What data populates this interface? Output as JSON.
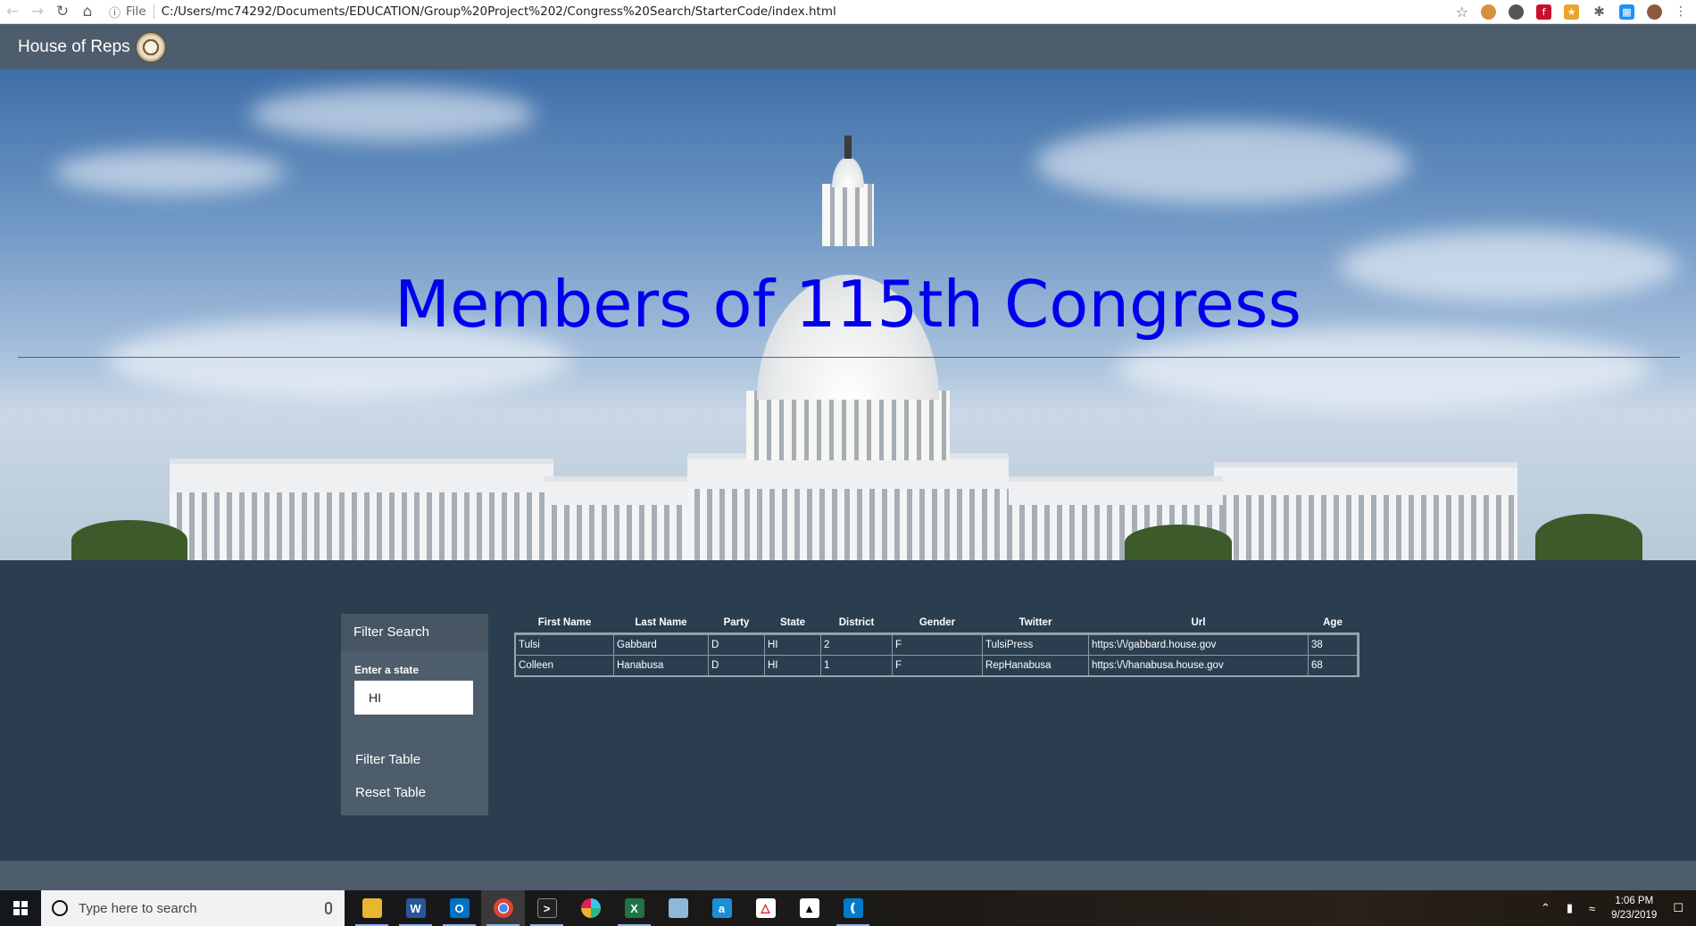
{
  "browser": {
    "protocol_label": "File",
    "url": "C:/Users/mc74292/Documents/EDUCATION/Group%20Project%202/Congress%20Search/StarterCode/index.html"
  },
  "navbar": {
    "brand": "House of Reps"
  },
  "hero": {
    "title": "Members of 115th Congress"
  },
  "filter": {
    "header": "Filter Search",
    "label": "Enter a state",
    "input_value": "HI",
    "filter_button": "Filter Table",
    "reset_button": "Reset Table"
  },
  "table": {
    "columns": [
      "First Name",
      "Last Name",
      "Party",
      "State",
      "District",
      "Gender",
      "Twitter",
      "Url",
      "Age"
    ],
    "rows": [
      [
        "Tulsi",
        "Gabbard",
        "D",
        "HI",
        "2",
        "F",
        "TulsiPress",
        "https:\\/\\/gabbard.house.gov",
        "38"
      ],
      [
        "Colleen",
        "Hanabusa",
        "D",
        "HI",
        "1",
        "F",
        "RepHanabusa",
        "https:\\/\\/hanabusa.house.gov",
        "68"
      ]
    ]
  },
  "taskbar": {
    "search_placeholder": "Type here to search",
    "time": "1:06 PM",
    "date": "9/23/2019"
  }
}
